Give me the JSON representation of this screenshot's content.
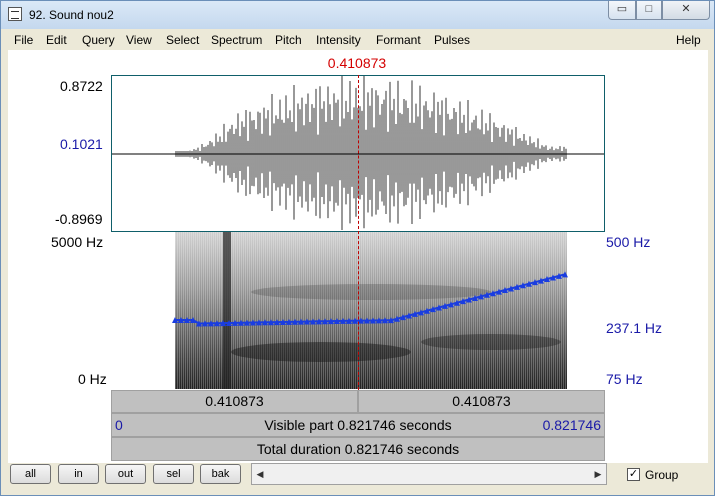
{
  "window": {
    "title": "92. Sound nou2",
    "min": "▭",
    "max": "□",
    "close": "✕"
  },
  "menu": [
    "File",
    "Edit",
    "Query",
    "View",
    "Select",
    "Spectrum",
    "Pitch",
    "Intensity",
    "Formant",
    "Pulses",
    "Help"
  ],
  "cursor_time": "0.410873",
  "waveform": {
    "y_max": "0.8722",
    "y_mid": "0.1021",
    "y_min": "-0.8969"
  },
  "spectrogram": {
    "freq_top": "5000 Hz",
    "freq_bottom": "0 Hz"
  },
  "pitch": {
    "top": "500 Hz",
    "current": "237.1 Hz",
    "bottom": "75 Hz"
  },
  "time_bar": {
    "left_segment": "0.410873",
    "right_segment": "0.410873"
  },
  "visible_bar": {
    "start": "0",
    "label": "Visible part 0.821746 seconds",
    "end": "0.821746"
  },
  "total_bar": {
    "label": "Total duration 0.821746 seconds"
  },
  "buttons": [
    "all",
    "in",
    "out",
    "sel",
    "bak"
  ],
  "group": {
    "label": "Group",
    "checked": "✓"
  }
}
